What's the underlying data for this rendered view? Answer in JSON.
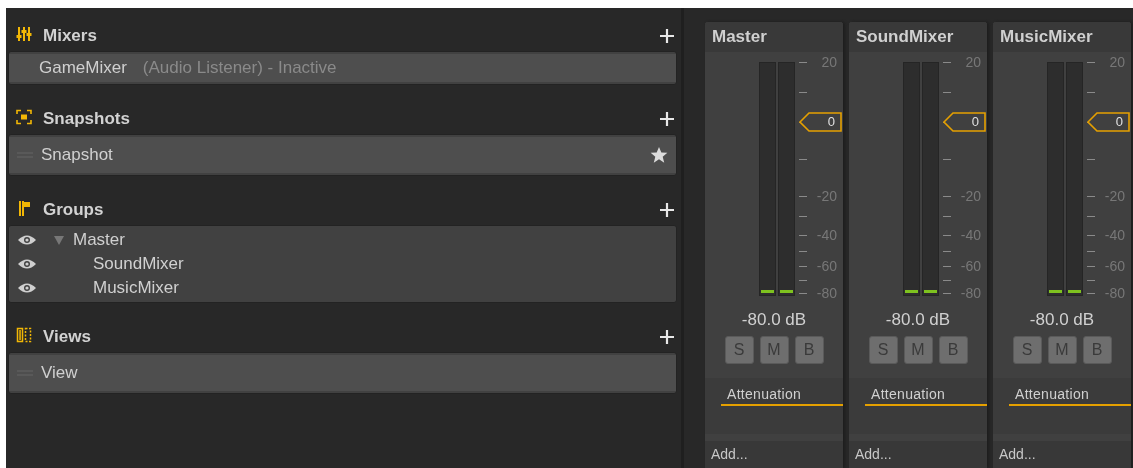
{
  "sections": [
    {
      "kind": "mixers",
      "title": "Mixers",
      "items": [
        {
          "name": "GameMixer",
          "note": "(Audio Listener) - Inactive"
        }
      ]
    },
    {
      "kind": "snapshots",
      "title": "Snapshots",
      "items": [
        {
          "name": "Snapshot",
          "start": true
        }
      ]
    },
    {
      "kind": "groups",
      "title": "Groups",
      "items": [
        {
          "name": "Master",
          "visible": true,
          "expanded": true,
          "children": [
            {
              "name": "SoundMixer",
              "visible": true
            },
            {
              "name": "MusicMixer",
              "visible": true
            }
          ]
        }
      ]
    },
    {
      "kind": "views",
      "title": "Views",
      "items": [
        {
          "name": "View"
        }
      ]
    }
  ],
  "strips": [
    {
      "name": "Master",
      "scale": [
        "20",
        "-20",
        "-40",
        "-60",
        "-80"
      ],
      "fader": "0",
      "meters": [
        {
          "level": 0
        },
        {
          "level": 0
        }
      ],
      "reading": "-80.0 dB",
      "buttons": [
        {
          "label": "S",
          "on": false
        },
        {
          "label": "M",
          "on": false
        },
        {
          "label": "B",
          "on": false
        }
      ],
      "effects": [
        "Attenuation"
      ],
      "add": "Add..."
    },
    {
      "name": "SoundMixer",
      "scale": [
        "20",
        "-20",
        "-40",
        "-60",
        "-80"
      ],
      "fader": "0",
      "meters": [
        {
          "level": 0
        },
        {
          "level": 0
        }
      ],
      "reading": "-80.0 dB",
      "buttons": [
        {
          "label": "S",
          "on": false
        },
        {
          "label": "M",
          "on": false
        },
        {
          "label": "B",
          "on": false
        }
      ],
      "effects": [
        "Attenuation"
      ],
      "add": "Add..."
    },
    {
      "name": "MusicMixer",
      "scale": [
        "20",
        "-20",
        "-40",
        "-60",
        "-80"
      ],
      "fader": "0",
      "meters": [
        {
          "level": 0
        },
        {
          "level": 0
        }
      ],
      "reading": "-80.0 dB",
      "buttons": [
        {
          "label": "S",
          "on": false
        },
        {
          "label": "M",
          "on": false
        },
        {
          "label": "B",
          "on": false
        }
      ],
      "effects": [
        "Attenuation"
      ],
      "add": "Add..."
    }
  ]
}
